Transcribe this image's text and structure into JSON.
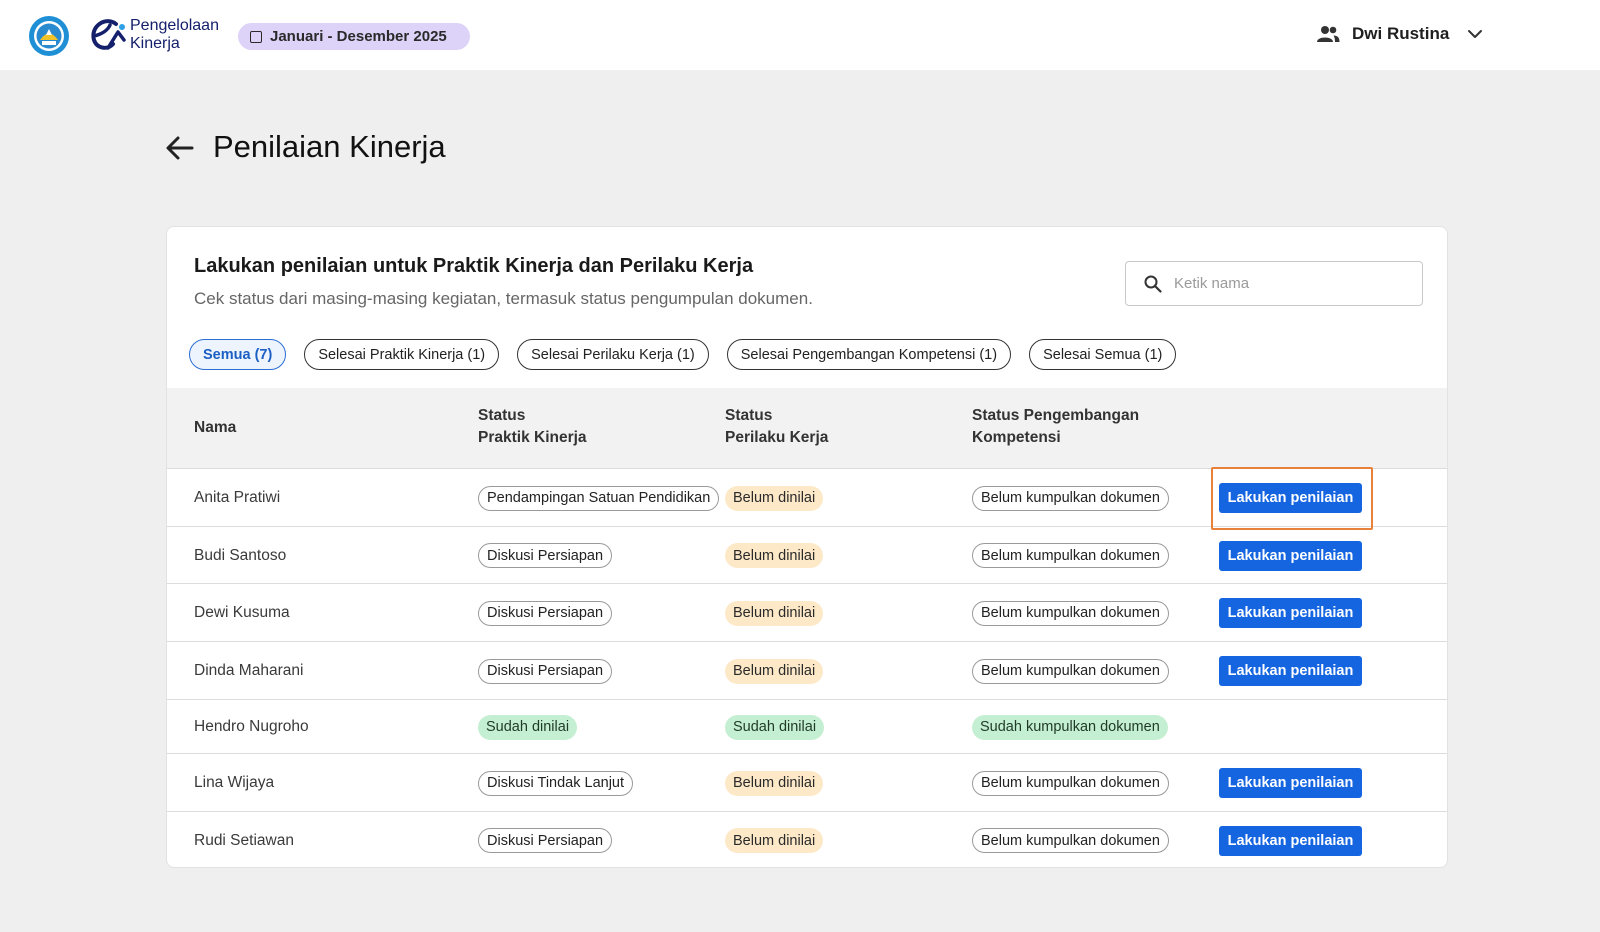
{
  "header": {
    "app_name_line1": "Pengelolaan",
    "app_name_line2": "Kinerja",
    "period": "Januari - Desember 2025",
    "user_name": "Dwi Rustina",
    "icons": {
      "emblem": "tut-wuri-handayani-emblem-icon",
      "logo": "pengelolaan-kinerja-logo-icon",
      "user": "user-group-icon",
      "chevron": "chevron-down-icon"
    }
  },
  "page": {
    "title": "Penilaian Kinerja",
    "back_icon": "arrow-left-icon"
  },
  "card": {
    "title": "Lakukan penilaian untuk Praktik Kinerja dan Perilaku Kerja",
    "subtitle": "Cek status dari masing-masing kegiatan, termasuk status pengumpulan dokumen.",
    "search_placeholder": "Ketik nama",
    "filters": [
      "Semua (7)",
      "Selesai Praktik Kinerja (1)",
      "Selesai Perilaku Kerja (1)",
      "Selesai Pengembangan Kompetensi (1)",
      "Selesai Semua (1)"
    ],
    "active_filter": "Semua (7)"
  },
  "table": {
    "headers": {
      "name": "Nama",
      "praktik_1": "Status",
      "praktik_2": "Praktik Kinerja",
      "perilaku_1": "Status",
      "perilaku_2": "Perilaku Kerja",
      "kompetensi_1": "Status Pengembangan",
      "kompetensi_2": "Kompetensi"
    },
    "action_label": "Lakukan penilaian",
    "rows": [
      {
        "name": "Anita Pratiwi",
        "praktik": "Pendampingan Satuan Pendidikan",
        "perilaku": "Belum dinilai",
        "kompetensi": "Belum kumpulkan dokumen",
        "action": "Lakukan penilaian"
      },
      {
        "name": "Budi Santoso",
        "praktik": "Diskusi Persiapan",
        "perilaku": "Belum dinilai",
        "kompetensi": "Belum kumpulkan dokumen",
        "action": "Lakukan penilaian"
      },
      {
        "name": "Dewi Kusuma",
        "praktik": "Diskusi Persiapan",
        "perilaku": "Belum dinilai",
        "kompetensi": "Belum kumpulkan dokumen",
        "action": "Lakukan penilaian"
      },
      {
        "name": "Dinda Maharani",
        "praktik": "Diskusi Persiapan",
        "perilaku": "Belum dinilai",
        "kompetensi": "Belum kumpulkan dokumen",
        "action": "Lakukan penilaian"
      },
      {
        "name": "Hendro Nugroho",
        "praktik": "Sudah dinilai",
        "perilaku": "Sudah dinilai",
        "kompetensi": "Sudah kumpulkan dokumen",
        "action": ""
      },
      {
        "name": "Lina Wijaya",
        "praktik": "Diskusi Tindak Lanjut",
        "perilaku": "Belum dinilai",
        "kompetensi": "Belum kumpulkan dokumen",
        "action": "Lakukan penilaian"
      },
      {
        "name": "Rudi Setiawan",
        "praktik": "Diskusi Persiapan",
        "perilaku": "Belum dinilai",
        "kompetensi": "Belum kumpulkan dokumen",
        "action": "Lakukan penilaian"
      }
    ]
  },
  "colors": {
    "primary": "#1565e0",
    "period_pill": "#ddd2f7",
    "warn_badge": "#fde9c8",
    "ok_badge": "#c5efd2",
    "highlight": "#e8823a"
  }
}
